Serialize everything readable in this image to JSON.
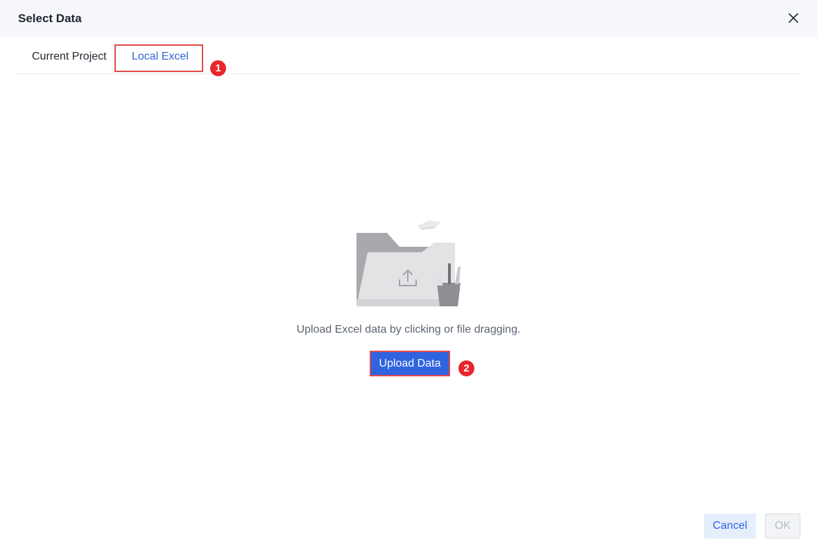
{
  "dialog": {
    "title": "Select Data",
    "close_icon": "close-icon"
  },
  "tabs": [
    {
      "label": "Current Project",
      "active": false
    },
    {
      "label": "Local Excel",
      "active": true
    }
  ],
  "annotations": {
    "step1": "1",
    "step2": "2",
    "highlight_color": "#e34a4a",
    "badge_color": "#e8262b"
  },
  "upload": {
    "illustration_icon": "folder-upload-icon",
    "hint": "Upload Excel data by clicking or file dragging.",
    "button_label": "Upload Data"
  },
  "footer": {
    "cancel_label": "Cancel",
    "ok_label": "OK",
    "ok_disabled": true
  },
  "colors": {
    "accent": "#2f63e0",
    "active_tab": "#3366d6"
  }
}
